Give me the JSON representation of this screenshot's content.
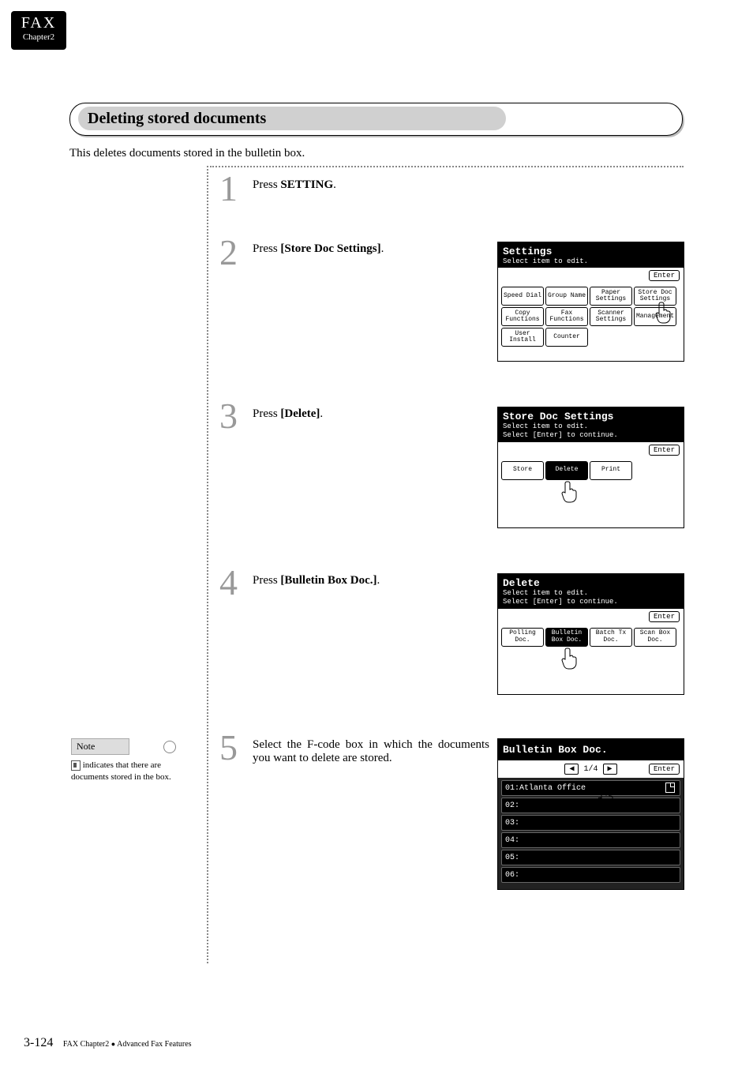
{
  "tab": {
    "title": "FAX",
    "subtitle": "Chapter2"
  },
  "section_title": "Deleting stored documents",
  "intro": "This deletes documents stored in the bulletin box.",
  "steps": {
    "1": {
      "pre": "Press ",
      "bold": "SETTING",
      "post": "."
    },
    "2": {
      "pre": "Press ",
      "bold": "[Store Doc Settings]",
      "post": "."
    },
    "3": {
      "pre": "Press ",
      "bold": "[Delete]",
      "post": "."
    },
    "4": {
      "pre": "Press ",
      "bold": "[Bulletin Box Doc.]",
      "post": "."
    },
    "5": {
      "text": "Select the F-code box in which the documents you want to delete are stored."
    }
  },
  "note": {
    "label": "Note",
    "body_after_icon": " indicates that there are documents stored in the box."
  },
  "lcd2": {
    "title": "Settings",
    "sub": "Select item to edit.",
    "enter": "Enter",
    "buttons": [
      "Speed Dial",
      "Group Name",
      "Paper\nSettings",
      "Store Doc\nSettings",
      "Copy\nFunctions",
      "Fax\nFunctions",
      "Scanner\nSettings",
      "Management",
      "User\nInstall",
      "Counter"
    ]
  },
  "lcd3": {
    "title": "Store Doc Settings",
    "sub1": "Select item to edit.",
    "sub2": "Select [Enter] to continue.",
    "enter": "Enter",
    "buttons": [
      "Store",
      "Delete",
      "Print"
    ]
  },
  "lcd4": {
    "title": "Delete",
    "sub1": "Select item to edit.",
    "sub2": "Select [Enter] to continue.",
    "enter": "Enter",
    "buttons": [
      "Polling\nDoc.",
      "Bulletin\nBox Doc.",
      "Batch Tx\nDoc.",
      "Scan Box\nDoc."
    ]
  },
  "lcd5": {
    "title": "Bulletin Box Doc.",
    "page": "1/4",
    "enter": "Enter",
    "rows": [
      "01:Atlanta  Office",
      "02:",
      "03:",
      "04:",
      "05:",
      "06:"
    ]
  },
  "footer": {
    "page": "3-124",
    "chapter": "FAX Chapter2",
    "sep": "●",
    "section": "Advanced Fax Features"
  }
}
